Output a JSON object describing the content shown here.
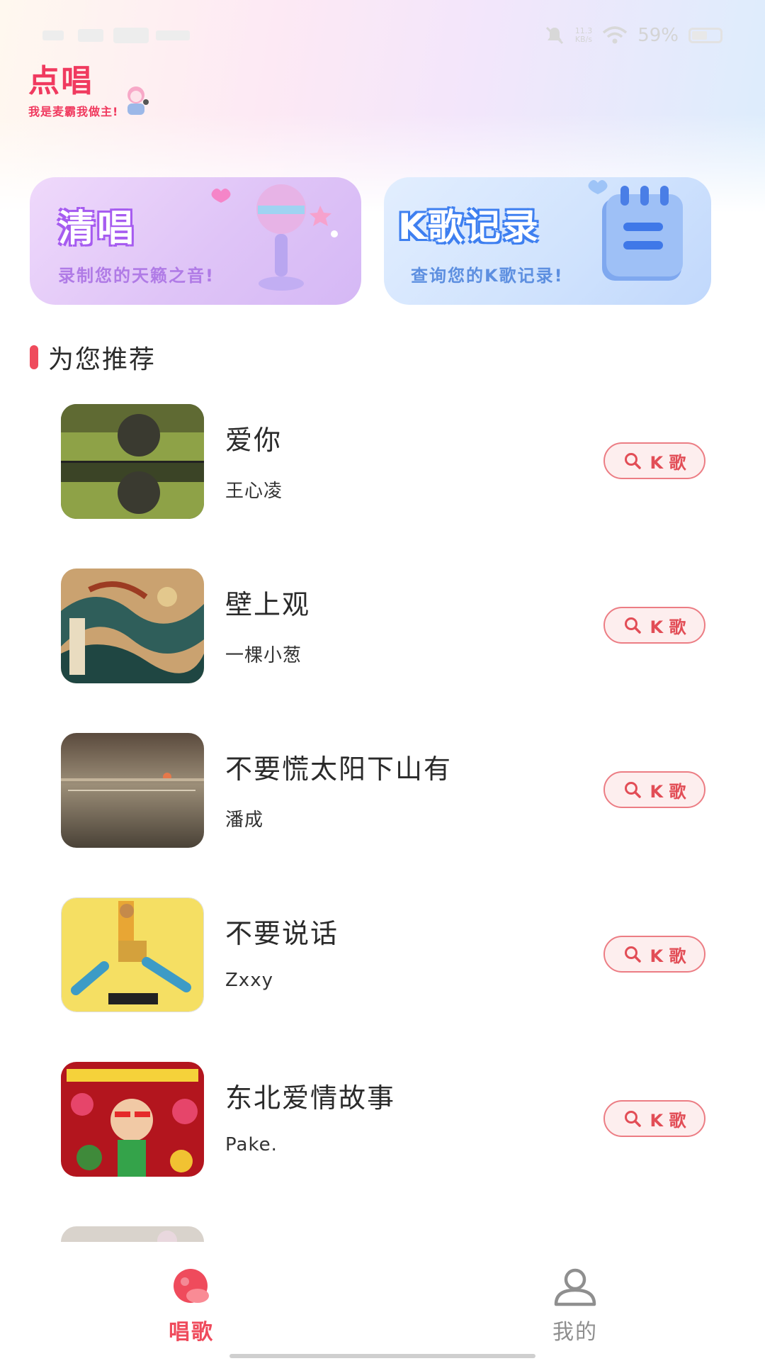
{
  "status_bar": {
    "left_text": "",
    "net_speed_value": "11.3",
    "net_speed_unit": "KB/s",
    "battery_percent": "59%",
    "battery_level": 0.59
  },
  "logo": {
    "title": "点唱",
    "subtitle": "我是麦霸我做主!"
  },
  "banners": [
    {
      "title": "清唱",
      "subtitle": "录制您的天籁之音!"
    },
    {
      "title": "K歌记录",
      "subtitle": "查询您的K歌记录!"
    }
  ],
  "section": {
    "title": "为您推荐"
  },
  "songs": [
    {
      "title": "爱你",
      "artist": "王心凌",
      "button": "K 歌"
    },
    {
      "title": "壁上观",
      "artist": "一棵小葱",
      "button": "K 歌"
    },
    {
      "title": "不要慌太阳下山有",
      "artist": "潘成",
      "button": "K 歌"
    },
    {
      "title": "不要说话",
      "artist": "Zxxy",
      "button": "K 歌"
    },
    {
      "title": "东北爱情故事",
      "artist": "Pake.",
      "button": "K 歌"
    }
  ],
  "tabs": [
    {
      "label": "唱歌",
      "active": true
    },
    {
      "label": "我的",
      "active": false
    }
  ],
  "colors": {
    "accent": "#ef4b5c",
    "button_border": "#ec7d84",
    "button_bg": "#fdeeee"
  },
  "icons": {
    "status": [
      "mute-icon",
      "wifi-icon",
      "battery-icon"
    ],
    "button": "search-icon",
    "tab_sing": "mic-icon",
    "tab_mine": "user-icon"
  }
}
